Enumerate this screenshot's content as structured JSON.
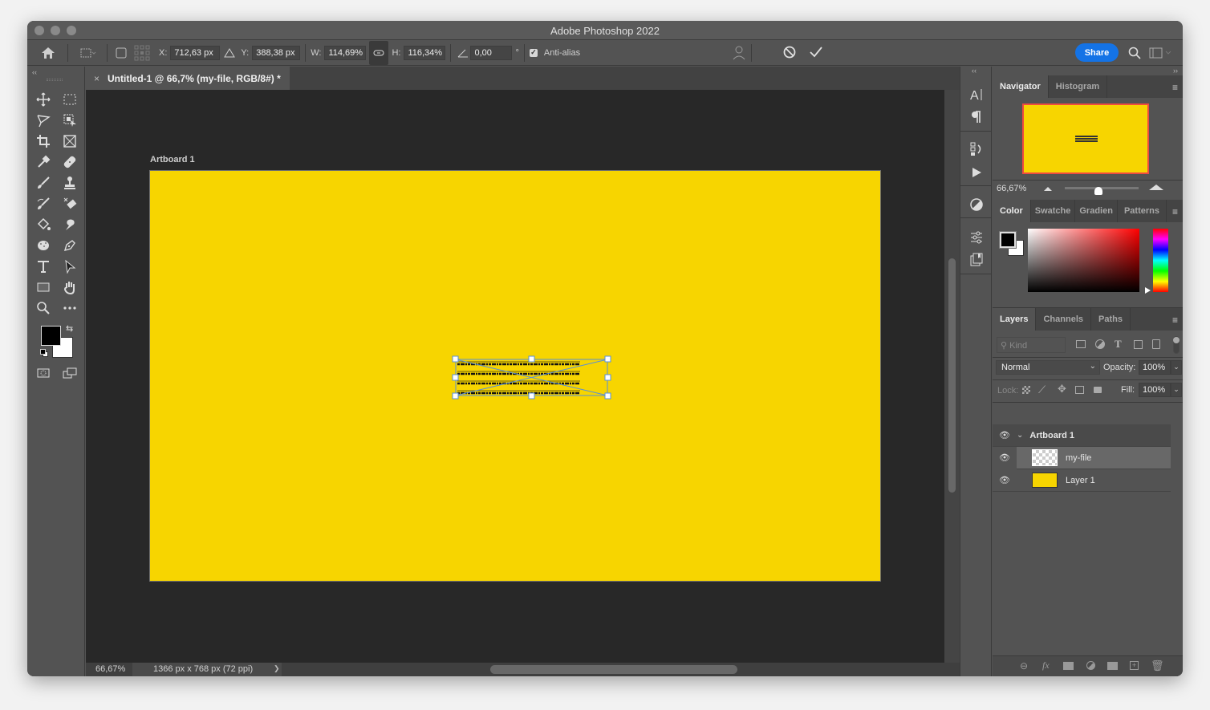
{
  "app": {
    "title": "Adobe Photoshop 2022",
    "accent_color": "#1473e6",
    "canvas_color": "#f7d500"
  },
  "options_bar": {
    "x_label": "X:",
    "x_value": "712,63 px",
    "y_label": "Y:",
    "y_value": "388,38 px",
    "w_label": "W:",
    "w_value": "114,69%",
    "h_label": "H:",
    "h_value": "116,34%",
    "angle_value": "0,00",
    "degree_symbol": "°",
    "anti_alias_label": "Anti-alias",
    "anti_alias_checked": true,
    "share_label": "Share"
  },
  "document": {
    "tab_title": "Untitled-1 @ 66,7% (my-file, RGB/8#) *",
    "close_glyph": "×",
    "artboard_label": "Artboard 1"
  },
  "status_bar": {
    "zoom": "66,67%",
    "doc_info": "1366 px x 768 px (72 ppi)",
    "arrow": "❯"
  },
  "navigator": {
    "tabs": [
      "Navigator",
      "Histogram"
    ],
    "zoom_value": "66,67%",
    "zoom_slider_fraction": 0.45
  },
  "color_panel": {
    "tabs": [
      "Color",
      "Swatche",
      "Gradien",
      "Patterns"
    ],
    "foreground": "#000000",
    "background": "#ffffff"
  },
  "layers_panel": {
    "tabs": [
      "Layers",
      "Channels",
      "Paths"
    ],
    "filter_placeholder": "Kind",
    "blend_mode": "Normal",
    "opacity_label": "Opacity:",
    "opacity_value": "100%",
    "lock_label": "Lock:",
    "fill_label": "Fill:",
    "fill_value": "100%",
    "layers": [
      {
        "name": "Artboard 1",
        "type": "artboard",
        "visible": true
      },
      {
        "name": "my-file",
        "type": "smart-object",
        "visible": true,
        "selected": true
      },
      {
        "name": "Layer 1",
        "type": "fill",
        "visible": true,
        "thumb_color": "#f7d500"
      }
    ]
  }
}
